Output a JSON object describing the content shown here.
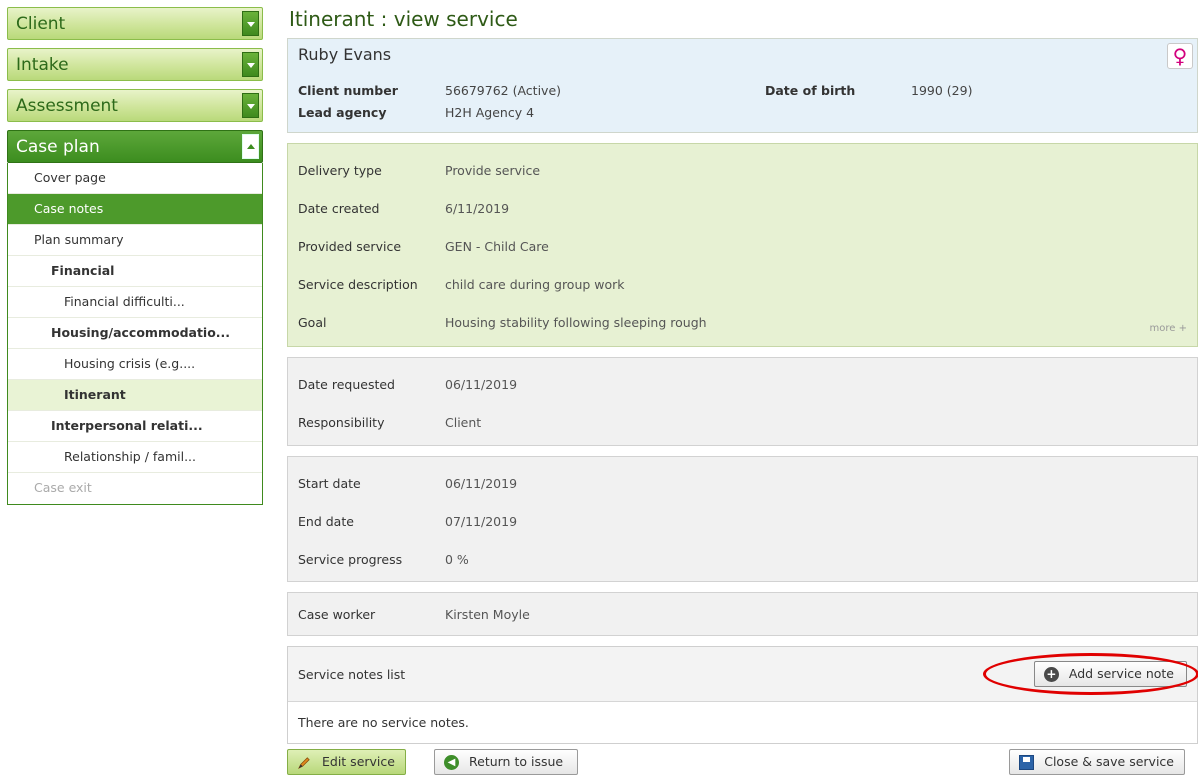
{
  "sidebar": {
    "sections": [
      "Client",
      "Intake",
      "Assessment",
      "Case plan"
    ],
    "items": [
      {
        "label": "Cover page"
      },
      {
        "label": "Case notes"
      },
      {
        "label": "Plan summary"
      },
      {
        "label": "Financial"
      },
      {
        "label": "Financial difficulti..."
      },
      {
        "label": "Housing/accommodatio..."
      },
      {
        "label": "Housing crisis (e.g...."
      },
      {
        "label": "Itinerant"
      },
      {
        "label": "Interpersonal relati..."
      },
      {
        "label": "Relationship / famil..."
      },
      {
        "label": "Case exit"
      }
    ]
  },
  "page": {
    "title": "Itinerant : view service"
  },
  "client": {
    "name": "Ruby Evans",
    "gender_icon": "female-icon",
    "client_number_label": "Client number",
    "client_number": "56679762 (Active)",
    "lead_agency_label": "Lead agency",
    "lead_agency": "H2H Agency 4",
    "dob_label": "Date of birth",
    "dob": "1990 (29)"
  },
  "service": {
    "rows": [
      {
        "label": "Delivery type",
        "value": "Provide service"
      },
      {
        "label": "Date created",
        "value": "6/11/2019"
      },
      {
        "label": "Provided service",
        "value": "GEN - Child Care"
      },
      {
        "label": "Service description",
        "value": "child care during group work"
      },
      {
        "label": "Goal",
        "value": "Housing stability following sleeping rough"
      }
    ],
    "more": "more +"
  },
  "request": {
    "rows": [
      {
        "label": "Date requested",
        "value": "06/11/2019"
      },
      {
        "label": "Responsibility",
        "value": "Client"
      }
    ]
  },
  "dates": {
    "rows": [
      {
        "label": "Start date",
        "value": "06/11/2019"
      },
      {
        "label": "End date",
        "value": "07/11/2019"
      },
      {
        "label": "Service progress",
        "value": "0 %"
      }
    ]
  },
  "worker": {
    "label": "Case worker",
    "value": "Kirsten Moyle"
  },
  "notes": {
    "title": "Service notes list",
    "add_label": "Add service note",
    "empty": "There are no service notes."
  },
  "actions": {
    "edit": "Edit service",
    "return": "Return to issue",
    "close_save": "Close & save service"
  },
  "colors": {
    "accent_green": "#4d9a2b",
    "client_panel": "#e6f1f9",
    "service_panel": "#e7f1d3",
    "highlight": "#e00000"
  }
}
